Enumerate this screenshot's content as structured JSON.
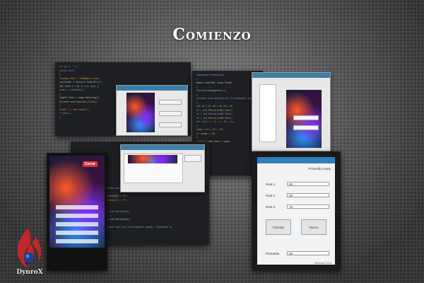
{
  "title": "Comienzo",
  "code_top_left": [
    "if (q == '') {",
    "  return null;",
    "}",
    "TextBox.Text = txtNumero.Text;",
    "resultado = Convert.ToInt32(n1);",
    "for (int i = 0; i < n; i++) {",
    "  suma += numeros[i];",
    "}",
    "label1.Text = suma.ToString();",
    "private void button1_Click()",
    "{",
    "  Form2 f = new Form2();",
    "  f.Show();",
    "}"
  ],
  "code_center": [
    "namespace Formulario",
    "{",
    "  public partial class Form1",
    "  {",
    "    InitializeComponent();",
    "  }",
    "  private void btnCalcular_Click(object sender, EventArgs e)",
    "  {",
    "    int n1 = 0, n2 = 0, n3 = 0;",
    "    n1 = int.Parse(txtN1.Text);",
    "    n2 = int.Parse(txtN2.Text);",
    "    n3 = int.Parse(txtN3.Text);",
    "    for (int i = 0; i < 10; i++)",
    "    {",
    "      suma = n1 + n2 + n3;",
    "      if (suma > 10)",
    "      {",
    "        lblResultado.Text = suma;",
    "      }",
    "    }",
    "  }",
    "}"
  ],
  "code_bottom_center": [
    "private void Form1_Load()",
    "{",
    "  valores[0] = \"1\";",
    "  valores[1] = \"2\";",
    "}",
    "",
    "n = int.Parse(txt);",
    "",
    "n = int.Parse(txt);",
    "",
    "private void btn_Click(object sender, EventArgs e)",
    "{",
    "}"
  ],
  "phone": {
    "close_label": "Cerrar"
  },
  "form": {
    "heading": "Promedio notas",
    "fields": [
      {
        "label": "Nota 1",
        "value": "50"
      },
      {
        "label": "Nota 2",
        "value": "60"
      },
      {
        "label": "Nota 3",
        "value": "70"
      }
    ],
    "buttons": [
      "Calcular",
      "Nuevo"
    ],
    "result_label": "Promedio",
    "result_value": "60",
    "footer": "Windows Forms"
  },
  "brand": {
    "name": "DynroX"
  },
  "colors": {
    "accent_blue": "#2f7fbf",
    "close_red": "#dd3333",
    "logo_red": "#c0262a"
  }
}
